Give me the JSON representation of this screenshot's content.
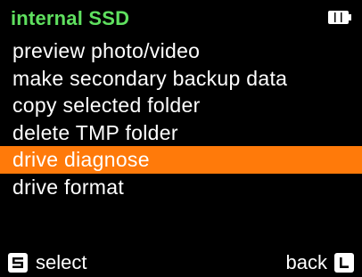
{
  "header": {
    "title": "internal SSD",
    "title_color": "#5fe05f",
    "battery_icon": "battery-full-icon"
  },
  "menu": {
    "selected_index": 4,
    "highlight_color": "#ff7a0a",
    "items": [
      {
        "label": "preview photo/video"
      },
      {
        "label": "make secondary backup data"
      },
      {
        "label": "copy selected folder"
      },
      {
        "label": "delete TMP folder"
      },
      {
        "label": "drive diagnose"
      },
      {
        "label": "drive format"
      }
    ]
  },
  "footer": {
    "left_key_icon": "s-key-icon",
    "left_label": "select",
    "right_label": "back",
    "right_key_icon": "l-key-icon"
  }
}
